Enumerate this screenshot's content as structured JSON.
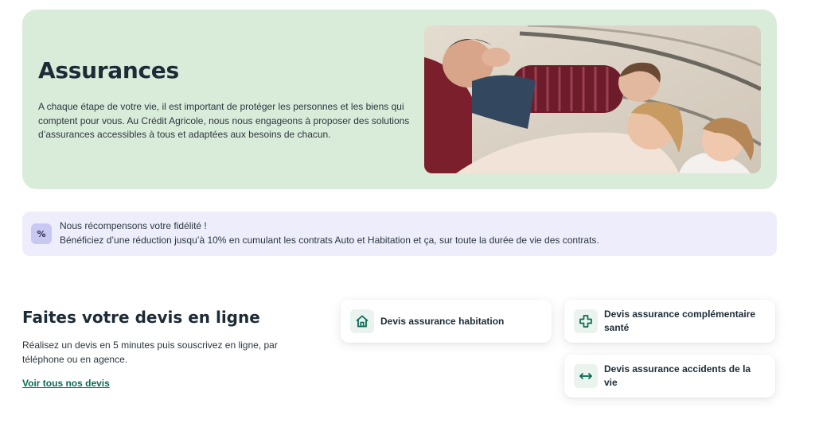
{
  "hero": {
    "title": "Assurances",
    "text": "A chaque étape de votre vie, il est important de protéger les personnes et les biens qui comptent pour vous. Au Crédit Agricole, nous nous engageons à proposer des solutions d’assurances accessibles à tous et adaptées aux besoins de chacun."
  },
  "loyalty": {
    "icon": "percent-icon",
    "icon_glyph": "%",
    "title": "Nous récompensons votre fidélité !",
    "text": "Bénéficiez d’une réduction jusqu’à 10% en cumulant les contrats Auto et Habitation et ça, sur toute la durée de vie des contrats."
  },
  "devis": {
    "title": "Faites votre devis en ligne",
    "text": "Réalisez un devis en 5 minutes puis souscrivez en ligne, par téléphone ou en agence.",
    "link_label": "Voir tous nos devis",
    "cards": [
      {
        "label": "Devis assurance habitation",
        "icon": "house-icon"
      },
      {
        "label": "Devis assurance complémentaire santé",
        "icon": "health-cross-icon"
      },
      {
        "label": "Devis assurance accidents de la vie",
        "icon": "double-arrow-icon"
      }
    ]
  },
  "colors": {
    "hero_bg": "#d9ebd9",
    "loyalty_bg": "#eeedfb",
    "accent_green": "#0b6b53"
  }
}
